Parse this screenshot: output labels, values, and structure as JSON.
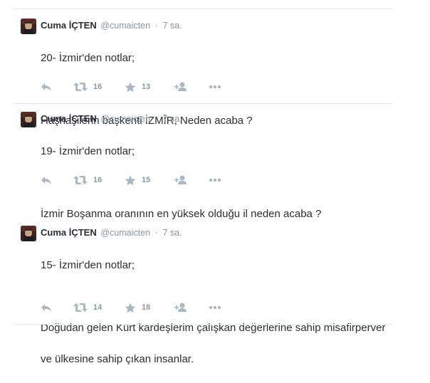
{
  "tweets": [
    {
      "author": {
        "name": "Cuma İÇTEN",
        "handle": "@cumaicten",
        "time": "7 sa."
      },
      "text_lines": [
        "20- İzmir'den notlar;",
        "",
        "Haşhaşilerin başkenti İZMİR, Neden acaba ?"
      ],
      "retweets": "16",
      "favorites": "13"
    },
    {
      "author": {
        "name": "Cuma İÇTEN",
        "handle": "@cumaicten",
        "time": "7 sa."
      },
      "text_lines": [
        "19- İzmir'den notlar;",
        "",
        "İzmir Boşanma oranının en yüksek olduğu il neden acaba ?"
      ],
      "retweets": "16",
      "favorites": "15"
    },
    {
      "author": {
        "name": "Cuma İÇTEN",
        "handle": "@cumaicten",
        "time": "7 sa."
      },
      "text_lines": [
        "15- İzmir'den notlar;",
        "",
        "Doğudan gelen Kürt kardeşlerim çalışkan değerlerine sahip misafirperver",
        "ve ülkesine sahip çıkan insanlar."
      ],
      "retweets": "14",
      "favorites": "18"
    }
  ],
  "separator": "·",
  "icons": {
    "reply": "reply-icon",
    "retweet": "retweet-icon",
    "favorite": "star-icon",
    "follow": "follow-icon",
    "more": "more-icon"
  },
  "colors": {
    "text": "#292f33",
    "muted": "#8899a6",
    "icon": "#aab8c2",
    "divider": "#e1e8ed"
  }
}
